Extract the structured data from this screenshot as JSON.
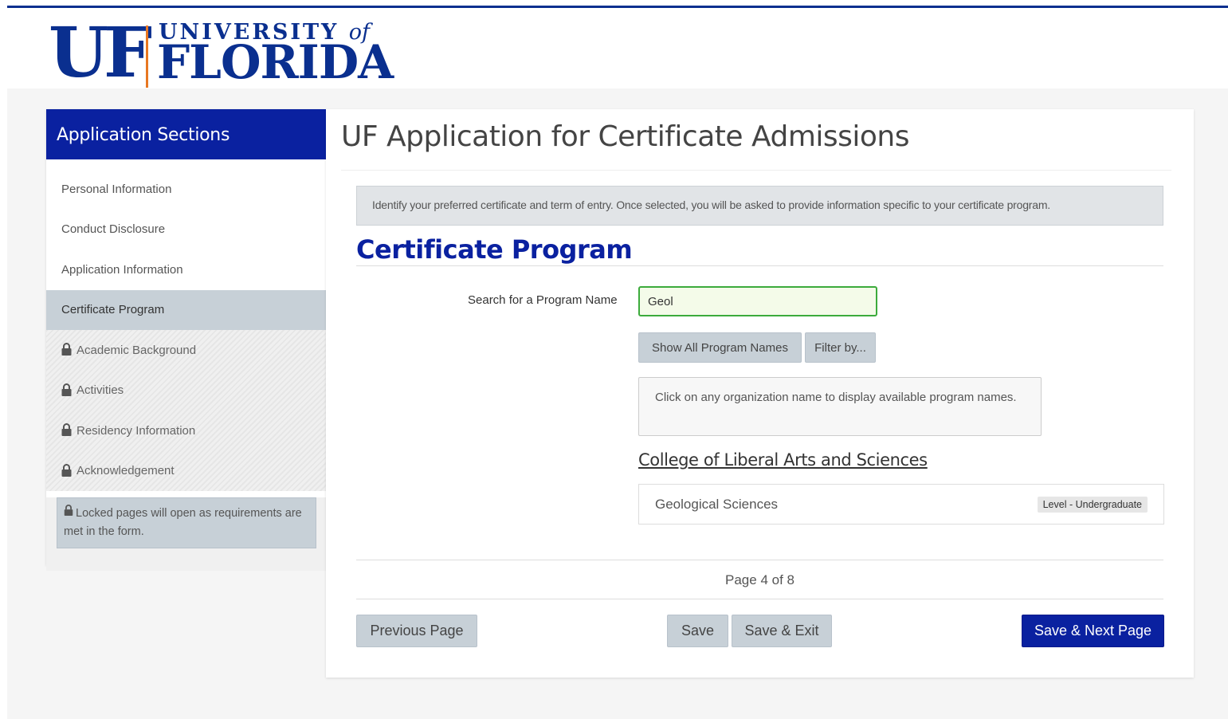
{
  "header": {
    "logo_uf": "UF",
    "logo_university": "UNIVERSITY",
    "logo_of": "of",
    "logo_florida": "FLORIDA"
  },
  "sidebar": {
    "title": "Application Sections",
    "items": [
      {
        "label": "Personal Information",
        "state": "normal"
      },
      {
        "label": "Conduct Disclosure",
        "state": "normal"
      },
      {
        "label": "Application Information",
        "state": "normal"
      },
      {
        "label": "Certificate Program",
        "state": "active"
      },
      {
        "label": "Academic Background",
        "state": "locked"
      },
      {
        "label": "Activities",
        "state": "locked"
      },
      {
        "label": "Residency Information",
        "state": "locked"
      },
      {
        "label": "Acknowledgement",
        "state": "locked"
      }
    ],
    "locked_note": "Locked pages will open as requirements are met in the form."
  },
  "main": {
    "title": "UF Application for Certificate Admissions",
    "info": "Identify your preferred certificate and term of entry. Once selected, you will be asked to provide information specific to your certificate program.",
    "section_title": "Certificate Program",
    "search": {
      "label": "Search for a Program Name",
      "value": "Geol"
    },
    "show_all_label": "Show All Program Names",
    "filter_label": "Filter by...",
    "hint": "Click on any organization name to display available program names.",
    "college": "College of Liberal Arts and Sciences",
    "program": {
      "name": "Geological Sciences",
      "level": "Level - Undergraduate"
    },
    "page_count": "Page 4 of 8",
    "buttons": {
      "previous": "Previous Page",
      "save": "Save",
      "save_exit": "Save & Exit",
      "save_next": "Save & Next Page"
    }
  },
  "colors": {
    "brand_blue": "#0a21a0",
    "logo_blue": "#0a2f8f",
    "logo_orange": "#e87722",
    "input_valid_border": "#3cab3c"
  }
}
